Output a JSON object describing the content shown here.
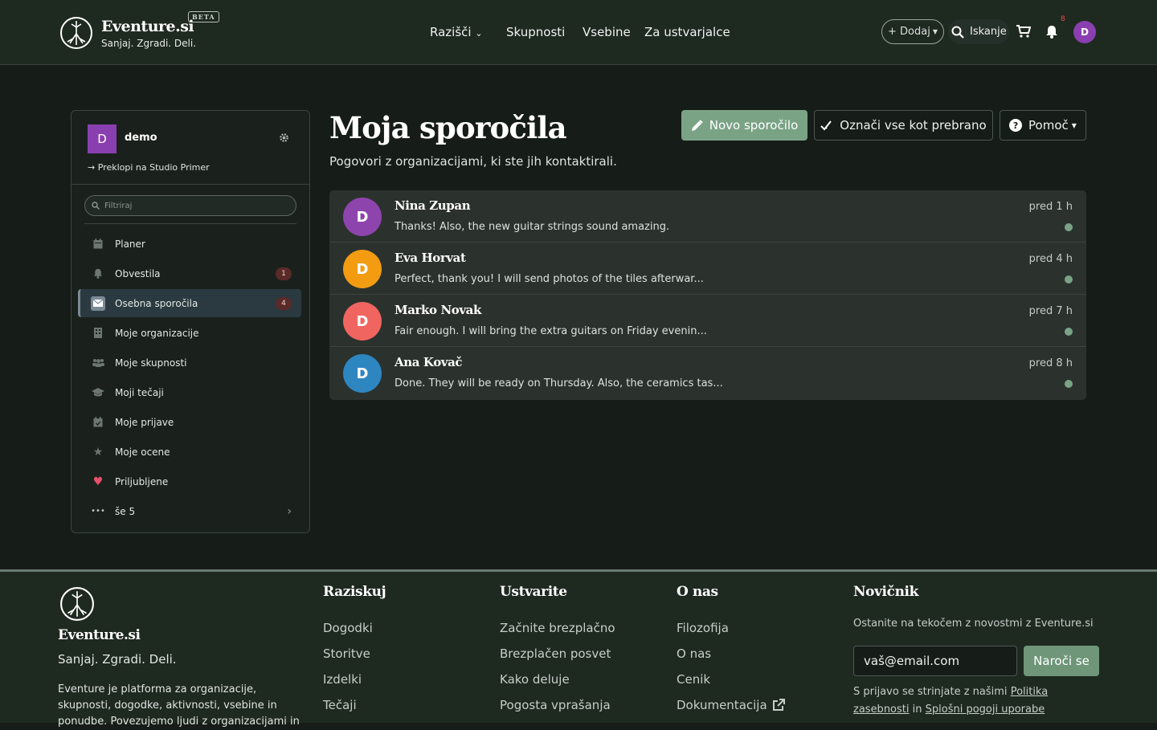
{
  "header": {
    "brand": "Eventure.si",
    "beta": "BETA",
    "tagline": "Sanjaj. Zgradi. Deli.",
    "nav": [
      "Razišči",
      "Skupnosti",
      "Vsebine",
      "Za ustvarjalce"
    ],
    "add_label": "+ Dodaj",
    "search_label": "Iskanje",
    "notif_count": "8",
    "avatar_letter": "D",
    "avatar_color": "#8a3fb0"
  },
  "sidebar": {
    "user_letter": "D",
    "user_name": "demo",
    "switch_label": "Preklopi na Studio Primer",
    "filter_placeholder": "Filtriraj",
    "items": [
      {
        "label": "Planer",
        "icon": "calendar-icon"
      },
      {
        "label": "Obvestila",
        "icon": "bell-icon",
        "count": "1"
      },
      {
        "label": "Osebna sporočila",
        "icon": "envelope-icon",
        "count": "4",
        "active": true
      },
      {
        "label": "Moje organizacije",
        "icon": "building-icon"
      },
      {
        "label": "Moje skupnosti",
        "icon": "users-icon"
      },
      {
        "label": "Moji tečaji",
        "icon": "graduation-cap-icon"
      },
      {
        "label": "Moje prijave",
        "icon": "calendar-check-icon"
      },
      {
        "label": "Moje ocene",
        "icon": "star-icon"
      },
      {
        "label": "Priljubljene",
        "icon": "heart-icon"
      },
      {
        "label": "še 5",
        "icon": "more-icon"
      }
    ]
  },
  "main": {
    "title": "Moja sporočila",
    "subtitle": "Pogovori z organizacijami, ki ste jih kontaktirali.",
    "new_message_label": "Novo sporočilo",
    "mark_read_label": "Označi vse kot prebrano",
    "help_label": "Pomoč",
    "conversations": [
      {
        "letter": "D",
        "color": "#8e44ad",
        "name": "Nina Zupan",
        "message": "Thanks! Also, the new guitar strings sound amazing.",
        "time": "pred 1 h"
      },
      {
        "letter": "D",
        "color": "#f39c12",
        "name": "Eva Horvat",
        "message": "Perfect, thank you! I will send photos of the tiles afterwar...",
        "time": "pred 4 h"
      },
      {
        "letter": "D",
        "color": "#f06560",
        "name": "Marko Novak",
        "message": "Fair enough. I will bring the extra guitars on Friday evenin...",
        "time": "pred 7 h"
      },
      {
        "letter": "D",
        "color": "#2e86c1",
        "name": "Ana Kovač",
        "message": "Done. They will be ready on Thursday. Also, the ceramics tas...",
        "time": "pred 8 h"
      }
    ]
  },
  "footer": {
    "brand": "Eventure.si",
    "tagline": "Sanjaj. Zgradi. Deli.",
    "description": "Eventure je platforma za organizacije, skupnosti, dogodke, aktivnosti, vsebine in ponudbe. Povezujemo ljudi z organizacijami in",
    "columns": [
      {
        "heading": "Raziskuj",
        "links": [
          "Dogodki",
          "Storitve",
          "Izdelki",
          "Tečaji"
        ]
      },
      {
        "heading": "Ustvarite",
        "links": [
          "Začnite brezplačno",
          "Brezplačen posvet",
          "Kako deluje",
          "Pogosta vprašanja"
        ]
      },
      {
        "heading": "O nas",
        "links": [
          "Filozofija",
          "O nas",
          "Cenik",
          "Dokumentacija"
        ]
      }
    ],
    "newsletter": {
      "heading": "Novičnik",
      "text": "Ostanite na tekočem z novostmi z Eventure.si",
      "email_value": "vaš@email.com",
      "subscribe_label": "Naroči se",
      "terms_prefix": "S prijavo se strinjate z našimi",
      "privacy_label": "Politika zasebnosti",
      "and": "in",
      "terms_label": "Splošni pogoji uporabe"
    }
  }
}
